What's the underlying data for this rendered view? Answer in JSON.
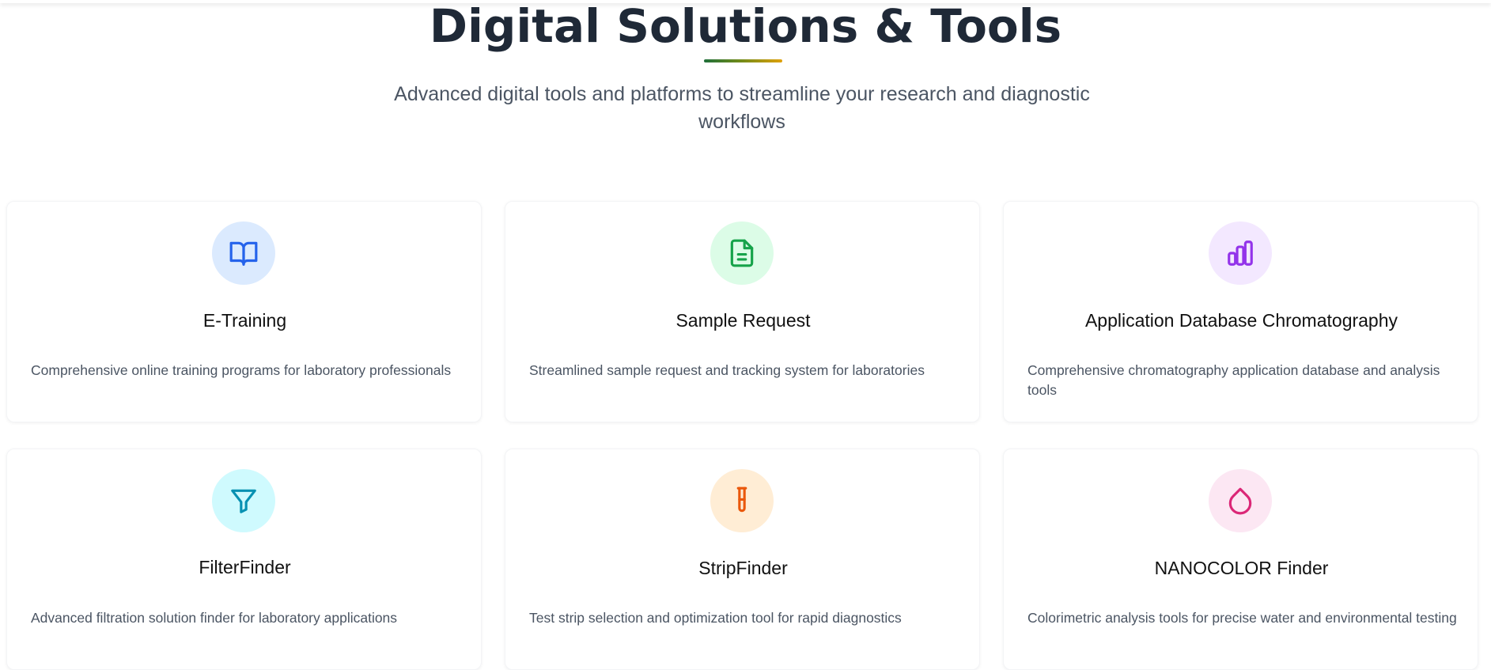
{
  "hero": {
    "title": "Digital Solutions & Tools",
    "subtitle": "Advanced digital tools and platforms to streamline your research and diagnostic workflows"
  },
  "cards": [
    {
      "title": "E-Training",
      "description": "Comprehensive online training programs for laboratory professionals",
      "icon": "book-open-icon",
      "icon_color": "#2563eb",
      "icon_bg": "#dbeafe"
    },
    {
      "title": "Sample Request",
      "description": "Streamlined sample request and tracking system for laboratories",
      "icon": "file-text-icon",
      "icon_color": "#16a34a",
      "icon_bg": "#dcfce7"
    },
    {
      "title": "Application Database Chromatography",
      "description": "Comprehensive chromatography application database and analysis tools",
      "icon": "bar-chart-icon",
      "icon_color": "#9333ea",
      "icon_bg": "#f3e8ff"
    },
    {
      "title": "FilterFinder",
      "description": "Advanced filtration solution finder for laboratory applications",
      "icon": "filter-icon",
      "icon_color": "#0891b2",
      "icon_bg": "#cffafe"
    },
    {
      "title": "StripFinder",
      "description": "Test strip selection and optimization tool for rapid diagnostics",
      "icon": "test-tube-icon",
      "icon_color": "#ea580c",
      "icon_bg": "#ffedd5"
    },
    {
      "title": "NANOCOLOR Finder",
      "description": "Colorimetric analysis tools for precise water and environmental testing",
      "icon": "droplet-icon",
      "icon_color": "#db2777",
      "icon_bg": "#fce7f3"
    }
  ]
}
